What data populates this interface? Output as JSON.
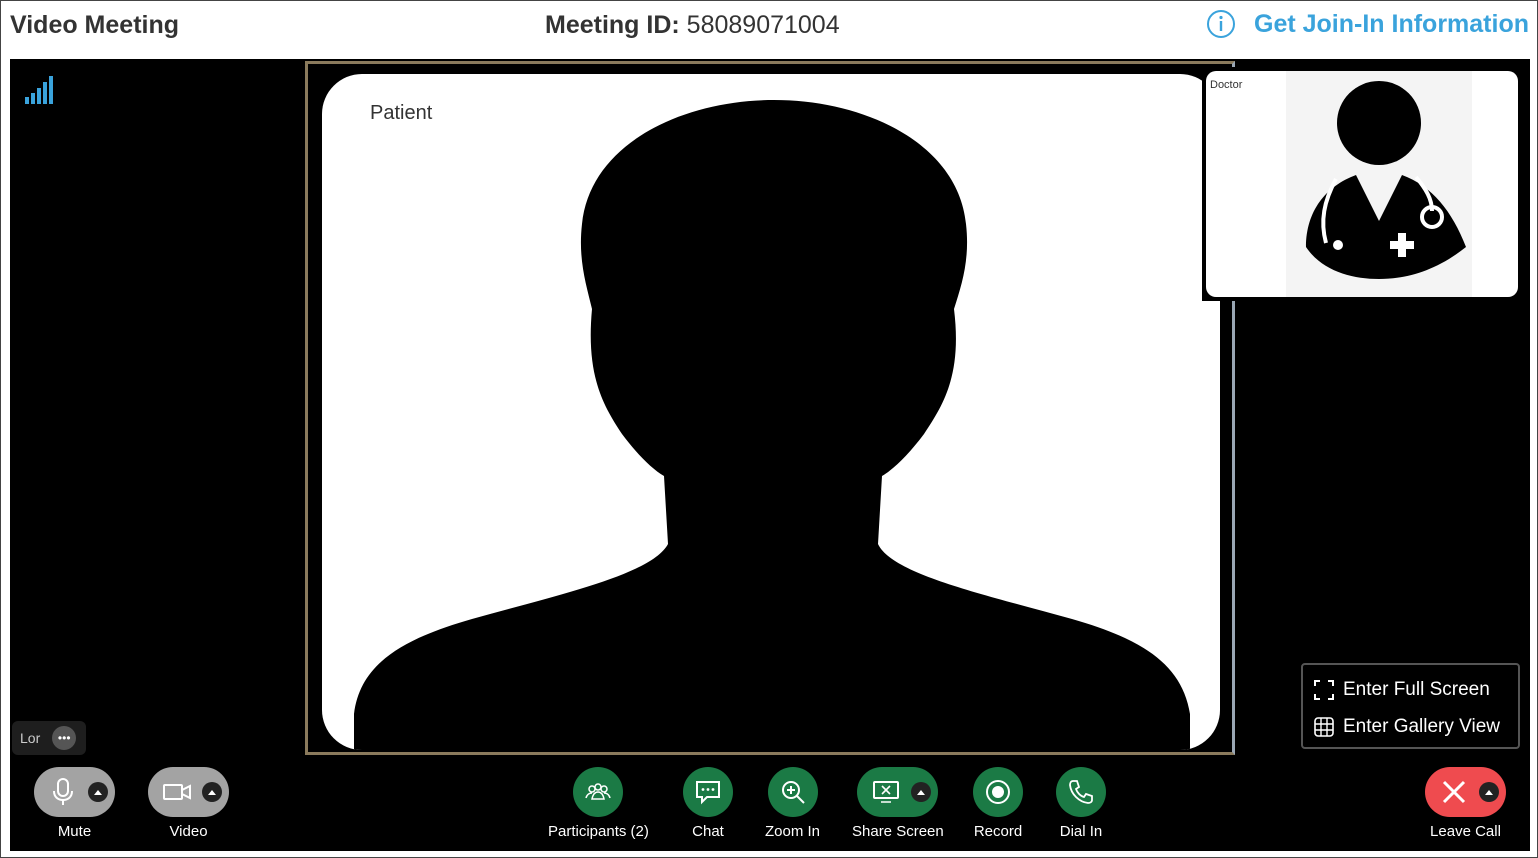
{
  "header": {
    "app_title": "Video Meeting",
    "meeting_id_label": "Meeting ID:",
    "meeting_id_value": "58089071004",
    "join_info_label": "Get Join-In Information",
    "join_info_icon": "info-icon",
    "accent_color": "#3aa3dc"
  },
  "stage": {
    "signal_icon": "signal-strength-icon",
    "main_video": {
      "label": "Patient",
      "avatar": "person-silhouette"
    },
    "pip_video": {
      "label": "Doctor",
      "avatar": "doctor-avatar"
    },
    "view_menu": {
      "items": [
        {
          "label": "Enter Full Screen",
          "icon": "fullscreen-icon"
        },
        {
          "label": "Enter Gallery View",
          "icon": "gallery-grid-icon"
        }
      ]
    },
    "self_tag": {
      "name": "Lor",
      "more_icon": "more-dots-icon"
    }
  },
  "toolbar": {
    "mute": {
      "label": "Mute",
      "icon": "microphone-icon"
    },
    "video": {
      "label": "Video",
      "icon": "video-camera-icon"
    },
    "participants": {
      "label": "Participants (2)",
      "icon": "participants-icon"
    },
    "chat": {
      "label": "Chat",
      "icon": "chat-icon"
    },
    "zoom_in": {
      "label": "Zoom In",
      "icon": "zoom-in-icon"
    },
    "share_screen": {
      "label": "Share Screen",
      "icon": "share-screen-icon"
    },
    "record": {
      "label": "Record",
      "icon": "record-icon"
    },
    "dial_in": {
      "label": "Dial In",
      "icon": "phone-icon"
    },
    "leave_call": {
      "label": "Leave Call",
      "icon": "close-icon"
    },
    "colors": {
      "green": "#1b7a45",
      "gray": "#a3a3a3",
      "red": "#ef4b4f"
    }
  }
}
